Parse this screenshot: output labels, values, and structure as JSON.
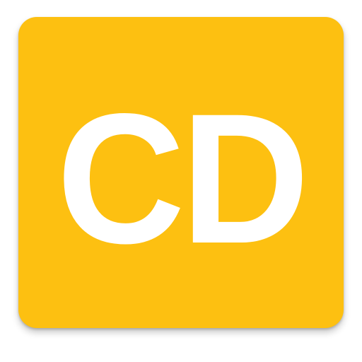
{
  "icon": {
    "text": "CD",
    "background_color": "#fdc011",
    "text_color": "#ffffff"
  }
}
